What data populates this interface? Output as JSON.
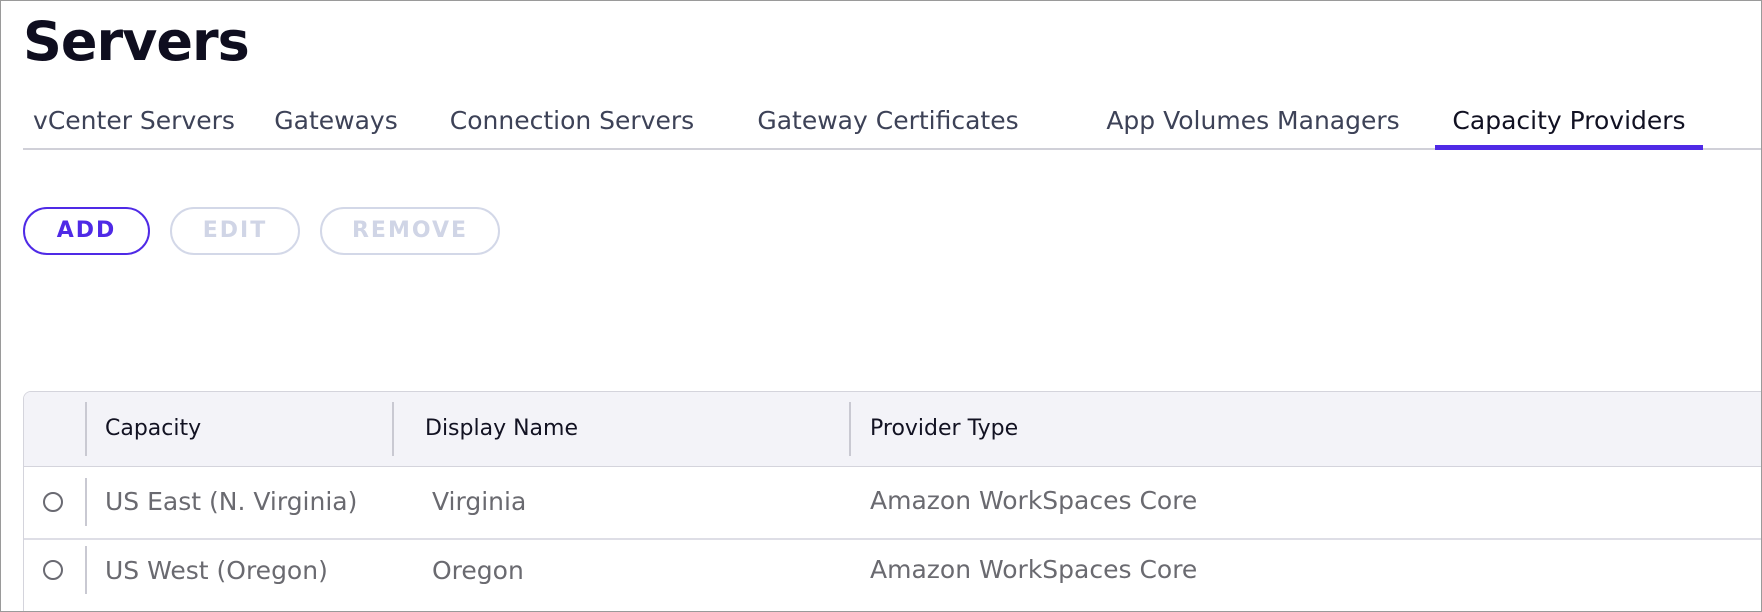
{
  "page": {
    "title": "Servers"
  },
  "tabs": [
    {
      "label": "vCenter Servers",
      "active": false
    },
    {
      "label": "Gateways",
      "active": false
    },
    {
      "label": "Connection Servers",
      "active": false
    },
    {
      "label": "Gateway Certificates",
      "active": false
    },
    {
      "label": "App Volumes Managers",
      "active": false
    },
    {
      "label": "Capacity Providers",
      "active": true
    }
  ],
  "toolbar": {
    "add_label": "ADD",
    "edit_label": "EDIT",
    "remove_label": "REMOVE",
    "edit_disabled": true,
    "remove_disabled": true
  },
  "table": {
    "columns": [
      "Capacity",
      "Display Name",
      "Provider Type"
    ],
    "rows": [
      {
        "selected": false,
        "capacity": "US East (N. Virginia)",
        "display_name": "Virginia",
        "provider_type": "Amazon WorkSpaces Core"
      },
      {
        "selected": false,
        "capacity": "US West (Oregon)",
        "display_name": "Oregon",
        "provider_type": "Amazon WorkSpaces Core"
      }
    ]
  },
  "colors": {
    "accent": "#4f2ae6",
    "disabled_border": "#d3d8e8",
    "header_bg": "#f3f3f8"
  }
}
